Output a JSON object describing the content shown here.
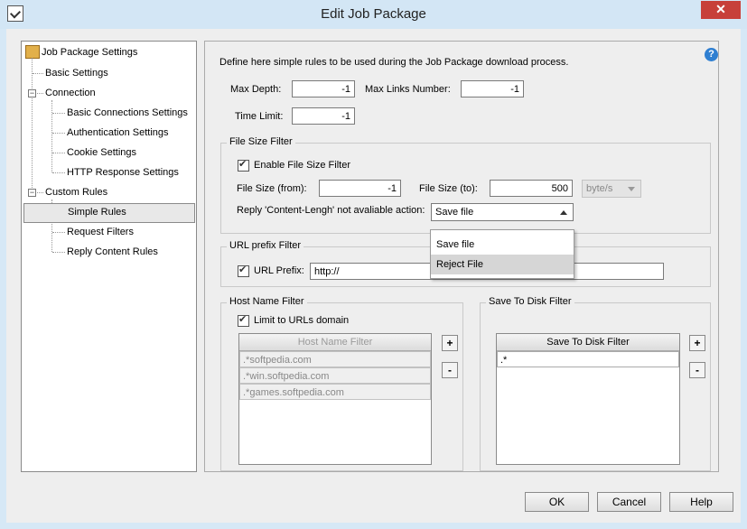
{
  "window": {
    "title": "Edit Job Package",
    "close_symbol": "✕"
  },
  "tree": {
    "root": "Job Package Settings",
    "basic_settings": "Basic Settings",
    "connection": "Connection",
    "basic_connections": "Basic Connections Settings",
    "authentication": "Authentication Settings",
    "cookie": "Cookie Settings",
    "http_response": "HTTP Response Settings",
    "custom_rules": "Custom Rules",
    "simple_rules": "Simple Rules",
    "request_filters": "Request Filters",
    "reply_content_rules": "Reply Content Rules",
    "expander_minus": "−"
  },
  "main": {
    "description": "Define here simple rules to be used during the Job Package download process.",
    "help_symbol": "?",
    "max_depth_label": "Max Depth:",
    "max_depth_value": "-1",
    "max_links_label": "Max Links Number:",
    "max_links_value": "-1",
    "time_limit_label": "Time Limit:",
    "time_limit_value": "-1"
  },
  "file_size_filter": {
    "title": "File Size Filter",
    "enable_label": "Enable File Size Filter",
    "from_label": "File Size (from):",
    "from_value": "-1",
    "to_label": "File Size (to):",
    "to_value": "500",
    "unit_value": "byte/s",
    "reply_label": "Reply 'Content-Lengh' not avaliable action:",
    "reply_value": "Save file",
    "options": [
      "Save file",
      "Reject File"
    ]
  },
  "url_prefix_filter": {
    "title": "URL prefix Filter",
    "label": "URL Prefix:",
    "value": "http://"
  },
  "host_name_filter": {
    "title": "Host Name Filter",
    "limit_label": "Limit to URLs domain",
    "column_header": "Host Name Filter",
    "rows": [
      ".*softpedia.com",
      ".*win.softpedia.com",
      ".*games.softpedia.com"
    ],
    "add": "+",
    "remove": "-"
  },
  "save_to_disk_filter": {
    "title": "Save To Disk Filter",
    "column_header": "Save To Disk Filter",
    "rows": [
      ".*"
    ],
    "add": "+",
    "remove": "-"
  },
  "buttons": {
    "ok": "OK",
    "cancel": "Cancel",
    "help": "Help"
  }
}
